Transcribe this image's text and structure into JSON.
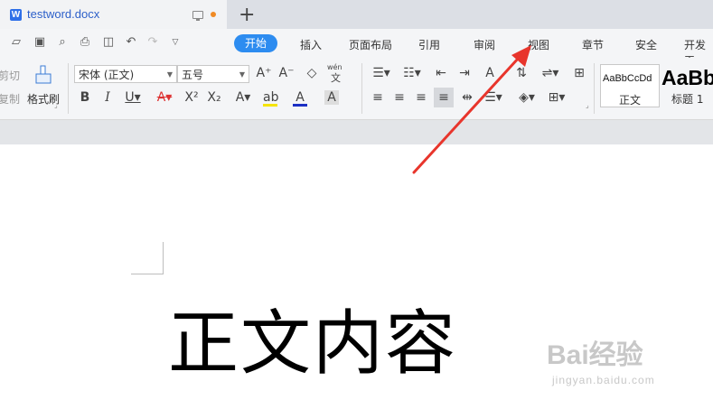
{
  "tabbar": {
    "doc_name": "testword.docx",
    "word_icon": "W",
    "new_tab_symbol": "+"
  },
  "menu": {
    "items": [
      "开始",
      "插入",
      "页面布局",
      "引用",
      "审阅",
      "视图",
      "章节",
      "安全",
      "开发工"
    ],
    "active": "开始"
  },
  "ribbon": {
    "clipboard": {
      "cut": "剪切",
      "copy": "复制",
      "format_painter": "格式刷"
    },
    "font": {
      "name": "宋体 (正文)",
      "size": "五号"
    },
    "styles": {
      "normal_preview": "AaBbCcDd",
      "normal_label": "正文",
      "heading_preview": "AaBb",
      "heading_label": "标题 1"
    },
    "phonetic": "wén"
  },
  "document": {
    "body_text": "正文内容"
  },
  "watermark": {
    "text": "Bai经验",
    "url": "jingyan.baidu.com"
  },
  "annotation": {
    "arrow_color": "#e8352c",
    "points_to": "视图"
  },
  "colors": {
    "accent": "#2d8cf0",
    "doc_name": "#2c5fc9",
    "unsaved_dot": "#f08a24",
    "highlight": "#f5e400",
    "font_color": "#1b2fc4"
  }
}
